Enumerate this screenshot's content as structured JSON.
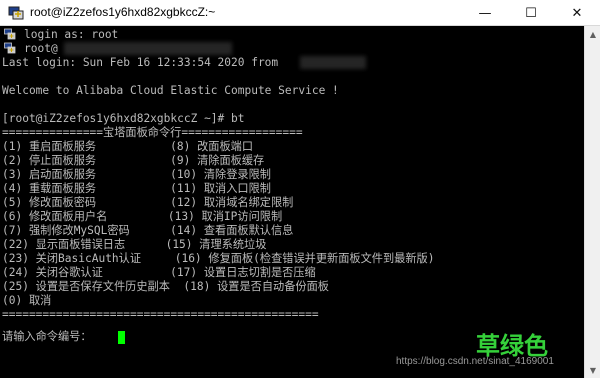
{
  "window": {
    "title": "root@iZ2zefos1y6hxd82xgbkccZ:~",
    "controls": {
      "minimize": "—",
      "maximize": "☐",
      "close": "✕"
    }
  },
  "terminal": {
    "lines": [
      "login as: root",
      "root@",
      "Last login: Sun Feb 16 12:33:54 2020 from",
      "",
      "Welcome to Alibaba Cloud Elastic Compute Service !",
      "",
      "[root@iZ2zefos1y6hxd82xgbkccZ ~]# bt",
      "===============宝塔面板命令行==================",
      "(1) 重启面板服务           (8) 改面板端口",
      "(2) 停止面板服务           (9) 清除面板缓存",
      "(3) 启动面板服务           (10) 清除登录限制",
      "(4) 重载面板服务           (11) 取消入口限制",
      "(5) 修改面板密码           (12) 取消域名绑定限制",
      "(6) 修改面板用户名         (13) 取消IP访问限制",
      "(7) 强制修改MySQL密码      (14) 查看面板默认信息",
      "(22) 显示面板错误日志      (15) 清理系统垃圾",
      "(23) 关闭BasicAuth认证     (16) 修复面板(检查错误并更新面板文件到最新版)",
      "(24) 关闭谷歌认证          (17) 设置日志切割是否压缩",
      "(25) 设置是否保存文件历史副本  (18) 设置是否自动备份面板",
      "(0) 取消",
      "===============================================",
      "请输入命令编号："
    ]
  },
  "watermark": {
    "brand": "草绿色",
    "url": "https://blog.csdn.net/sinat_4169001"
  },
  "colors": {
    "terminal_bg": "#000000",
    "terminal_fg": "#bbbbbb",
    "cursor": "#00ff00",
    "watermark_brand": "#35d13a"
  }
}
